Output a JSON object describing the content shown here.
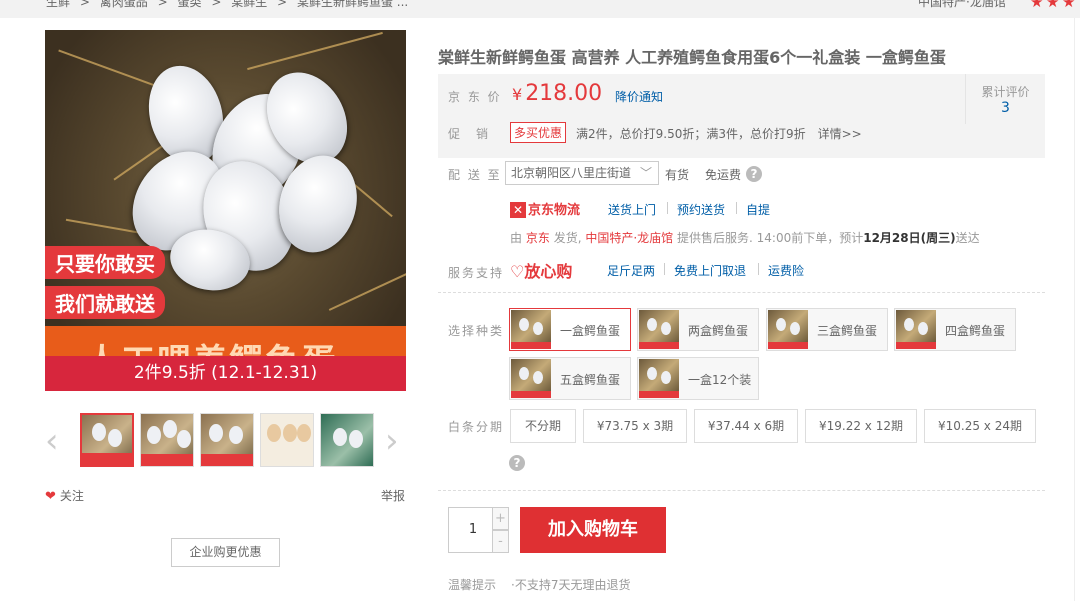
{
  "breadcrumb": [
    "生鲜",
    ">",
    "禽肉蛋品",
    ">",
    "蛋类",
    ">",
    "棠鲜生",
    ">",
    "棠鲜生新鲜鳄鱼蛋 ..."
  ],
  "shop": {
    "name": "中国特产·龙庙馆",
    "rating_stars": 3
  },
  "gallery": {
    "promo_line1": "只要你敢买",
    "promo_line2": "我们就敢送",
    "promo_big": "人工喂养鳄鱼蛋",
    "discount_bar": "2件9.5折 (12.1-12.31)",
    "prev_arrow": "‹",
    "next_arrow": "›",
    "follow": "关注",
    "report": "举报",
    "enterprise_button": "企业购更优惠"
  },
  "product": {
    "title": "棠鲜生新鲜鳄鱼蛋 高营养 人工养殖鳄鱼食用蛋6个一礼盒装 一盒鳄鱼蛋",
    "price_label": "京 东 价",
    "currency": "¥",
    "price": "218.00",
    "price_notify": "降价通知",
    "reviews_label": "累计评价",
    "reviews_count": "3",
    "promo_label": "促　销",
    "promo_tag": "多买优惠",
    "promo_text": "满2件，总价打9.50折；满3件，总价打9折　详情>>"
  },
  "delivery": {
    "label": "配 送 至",
    "address": "北京朝阳区八里庄街道",
    "stock": "有货",
    "shipping": "免运费",
    "logistics": "京东物流",
    "services": [
      "送货上门",
      "预约送货",
      "自提"
    ],
    "ship_prefix": "由",
    "ship_from": "京东",
    "ship_mid": "发货,",
    "seller": "中国特产·龙庙馆",
    "ship_after": "提供售后服务. 14:00前下单，预计",
    "eta": "12月28日(周三)",
    "ship_end": "送达"
  },
  "service": {
    "label": "服务支持",
    "badge": "♡放心购",
    "items": [
      "足斤足两",
      "免费上门取退",
      "运费险"
    ]
  },
  "variants": {
    "label": "选择种类",
    "options": [
      "一盒鳄鱼蛋",
      "两盒鳄鱼蛋",
      "三盒鳄鱼蛋",
      "四盒鳄鱼蛋",
      "五盒鳄鱼蛋",
      "一盒12个装"
    ],
    "selected_index": 0
  },
  "installments": {
    "label": "白条分期",
    "options": [
      "不分期",
      "¥73.75 x 3期",
      "¥37.44 x 6期",
      "¥19.22 x 12期",
      "¥10.25 x 24期"
    ]
  },
  "cart": {
    "quantity": "1",
    "plus": "+",
    "minus": "-",
    "add_button": "加入购物车",
    "tips_label": "温馨提示",
    "tips_text": "·不支持7天无理由退货"
  },
  "colors": {
    "accent": "#e4393c",
    "link": "#005ea7",
    "cart_button": "#df3033"
  }
}
